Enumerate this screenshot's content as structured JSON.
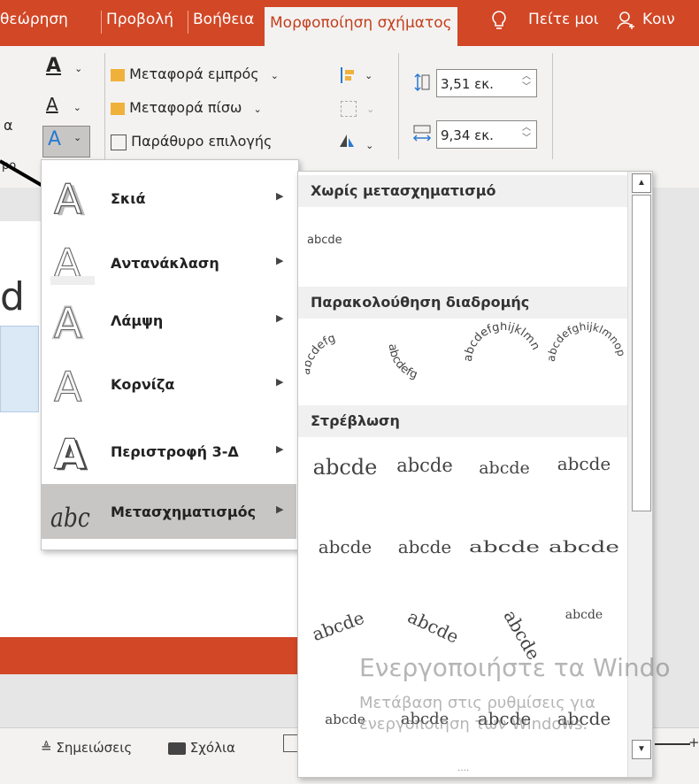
{
  "tabs": [
    {
      "label": "θεώρηση"
    },
    {
      "label": "Προβολή"
    },
    {
      "label": "Βοήθεια"
    },
    {
      "label": "Μορφοποίηση σχήματος",
      "active": true
    },
    {
      "label": "Πείτε μοι"
    },
    {
      "label": "Κοιν"
    }
  ],
  "ribbon": {
    "bring_forward": "Μεταφορά εμπρός",
    "send_backward": "Μεταφορά πίσω",
    "selection_pane": "Παράθυρο επιλογής",
    "height_value": "3,51 εκ.",
    "width_value": "9,34 εκ.",
    "left_clip_a": "α",
    "left_clip_b": "ρο"
  },
  "menu": {
    "items": [
      {
        "label": "Σκιά",
        "icon": "shadow-a-icon"
      },
      {
        "label": "Αντανάκλαση",
        "icon": "reflection-a-icon"
      },
      {
        "label": "Λάμψη",
        "icon": "glow-a-icon"
      },
      {
        "label": "Κορνίζα",
        "icon": "bevel-a-icon"
      },
      {
        "label": "Περιστροφή 3-Δ",
        "icon": "3d-rotation-a-icon"
      },
      {
        "label": "Μετασχηματισμός",
        "icon": "transform-abc-icon",
        "selected": true
      }
    ]
  },
  "panel": {
    "no_transform_heading": "Χωρίς μετασχηματισμό",
    "no_transform_sample": "abcde",
    "follow_path_heading": "Παρακολούθηση διαδρομής",
    "follow_path_samples": [
      "abcdefg",
      "abcdefg",
      "abcdefghijklmn",
      "abcdefghijklmnop"
    ],
    "warp_heading": "Στρέβλωση",
    "warp_samples": [
      "abcde",
      "abcde",
      "abcde",
      "abcde",
      "abcde",
      "abcde",
      "abcde",
      "abcde",
      "abcde",
      "abcde",
      "abcde",
      "abcde",
      "abcde",
      "abcde",
      "abcde",
      "abcde"
    ],
    "ellipsis": "...."
  },
  "watermark": {
    "line1": "Ενεργοποιήστε τα Windo",
    "line2": "Μετάβαση στις ρυθμίσεις για",
    "line3": "ενεργοποίηση των Windows."
  },
  "statusbar": {
    "notes": "Σημειώσεις",
    "comments": "Σχόλια"
  },
  "colors": {
    "accent": "#d24726",
    "menu_selected": "#c8c6c4"
  }
}
